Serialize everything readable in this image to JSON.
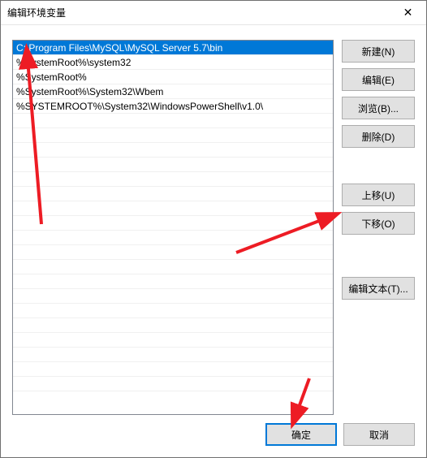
{
  "titlebar": {
    "title": "编辑环境变量",
    "close_glyph": "✕"
  },
  "list": {
    "items": [
      {
        "text": "C:\\Program Files\\MySQL\\MySQL Server 5.7\\bin",
        "selected": true
      },
      {
        "text": "%SystemRoot%\\system32",
        "selected": false
      },
      {
        "text": "%SystemRoot%",
        "selected": false
      },
      {
        "text": "%SystemRoot%\\System32\\Wbem",
        "selected": false
      },
      {
        "text": "%SYSTEMROOT%\\System32\\WindowsPowerShell\\v1.0\\",
        "selected": false
      }
    ]
  },
  "buttons": {
    "new": "新建(N)",
    "edit": "编辑(E)",
    "browse": "浏览(B)...",
    "delete": "删除(D)",
    "move_up": "上移(U)",
    "move_down": "下移(O)",
    "edit_text": "编辑文本(T)...",
    "ok": "确定",
    "cancel": "取消"
  },
  "annotations": {
    "arrow_color": "#ed1c24"
  }
}
